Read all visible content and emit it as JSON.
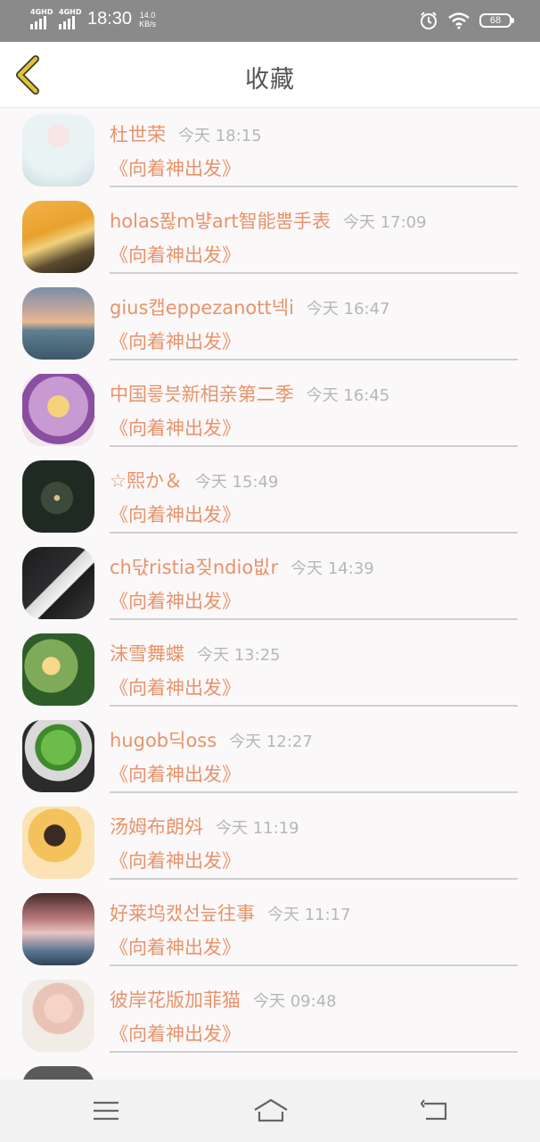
{
  "status_bar": {
    "network_1": "4GHD",
    "network_2": "4GHD",
    "time": "18:30",
    "speed_value": "14.0",
    "speed_unit": "KB/s",
    "battery": "68"
  },
  "header": {
    "title": "收藏"
  },
  "items": [
    {
      "name": "杜世荣",
      "time": "今天 18:15",
      "subtitle": "《向着神出发》"
    },
    {
      "name": "holas퐎m뱧art智能뿜手表",
      "time": "今天 17:09",
      "subtitle": "《向着神出发》"
    },
    {
      "name": "gius캡eppezanott넥i",
      "time": "今天 16:47",
      "subtitle": "《向着神出发》"
    },
    {
      "name": "中国릏븟新相亲第二季",
      "time": "今天 16:45",
      "subtitle": "《向着神出发》"
    },
    {
      "name": "☆熙か＆",
      "time": "今天 15:49",
      "subtitle": "《向着神出发》"
    },
    {
      "name": "ch댟ristia짖ndio빖r",
      "time": "今天 14:39",
      "subtitle": "《向着神出发》"
    },
    {
      "name": "沫雪舞蝶",
      "time": "今天 13:25",
      "subtitle": "《向着神出发》"
    },
    {
      "name": "hugob딕oss",
      "time": "今天 12:27",
      "subtitle": "《向着神出发》"
    },
    {
      "name": "汤姆布朗斘",
      "time": "今天 11:19",
      "subtitle": "《向着神出发》"
    },
    {
      "name": "好莱坞캤선늪往事",
      "time": "今天 11:17",
      "subtitle": "《向着神出发》"
    },
    {
      "name": "彼岸花版加菲猫",
      "time": "今天 09:48",
      "subtitle": "《向着神出发》"
    }
  ],
  "colors": {
    "accent": "#e8936a",
    "back_arrow": "#e0c23b"
  }
}
